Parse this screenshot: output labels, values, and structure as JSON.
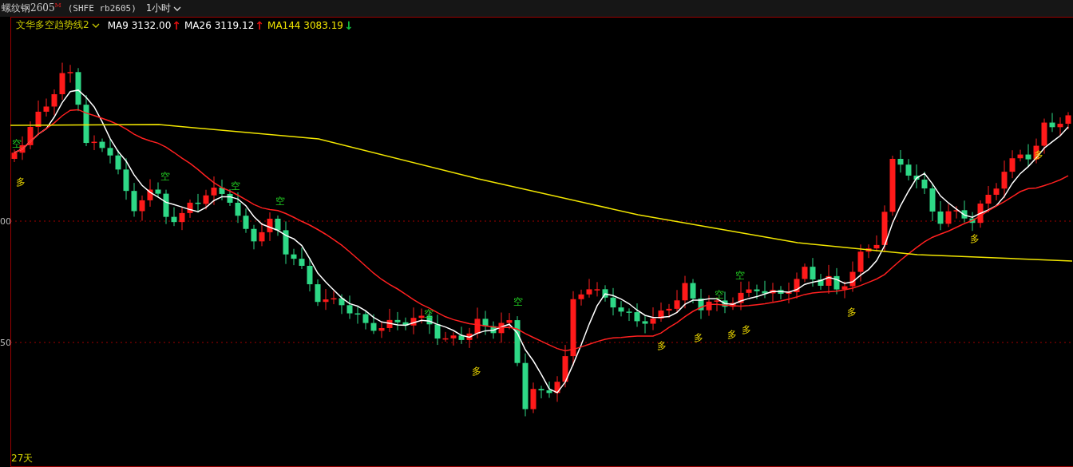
{
  "header": {
    "title": "螺纹钢2605$^{M}$",
    "exchange": "(SHFE rb2605)",
    "period": "1小时"
  },
  "indicator": {
    "name": "文华多空趋势线2",
    "averages": [
      {
        "label": "MA9",
        "value": "3132.00",
        "color": "#ffffff",
        "arrow": {
          "text": "↑",
          "color": "#e01010"
        }
      },
      {
        "label": "MA26",
        "value": "3119.12",
        "color": "#ffffff",
        "arrow": {
          "text": "↑",
          "color": "#e01010"
        }
      },
      {
        "label": "MA144",
        "value": "3083.19",
        "color": "#f2e600",
        "arrow": {
          "text": "↓",
          "color": "#10c040"
        }
      }
    ]
  },
  "price_axis": [
    "00",
    "50"
  ],
  "signals": [
    {
      "label": "空",
      "kind": "short"
    },
    {
      "label": "多",
      "kind": "long"
    },
    {
      "label": "空",
      "kind": "short"
    },
    {
      "label": "空",
      "kind": "short"
    },
    {
      "label": "空",
      "kind": "short"
    },
    {
      "label": "空",
      "kind": "short"
    },
    {
      "label": "多",
      "kind": "long"
    },
    {
      "label": "空",
      "kind": "short"
    },
    {
      "label": "多",
      "kind": "long"
    },
    {
      "label": "多",
      "kind": "long"
    },
    {
      "label": "空",
      "kind": "short"
    },
    {
      "label": "多",
      "kind": "long"
    },
    {
      "label": "空",
      "kind": "short"
    },
    {
      "label": "多",
      "kind": "long"
    },
    {
      "label": "多",
      "kind": "long"
    },
    {
      "label": "多",
      "kind": "long"
    },
    {
      "label": "多",
      "kind": "long"
    }
  ],
  "footer": {
    "span": "27天"
  }
}
